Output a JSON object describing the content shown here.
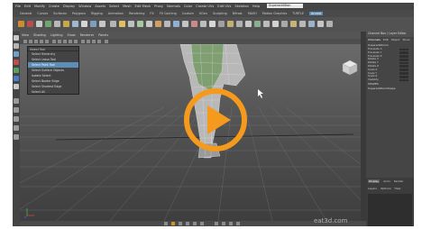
{
  "menubar": {
    "items": [
      "File",
      "Edit",
      "Modify",
      "Create",
      "Display",
      "Window",
      "Assets",
      "Select",
      "Mesh",
      "Edit Mesh",
      "Proxy",
      "Normals",
      "Color",
      "Create UVs",
      "Edit UVs",
      "Skeleton",
      "Help"
    ],
    "search_value": "Superaddition"
  },
  "modebar": {
    "items": [
      "General",
      "Curves",
      "Surfaces",
      "Polygons",
      "Rigging",
      "Animation",
      "Rendering",
      "FX",
      "FX Caching",
      "Custom",
      "XGen",
      "Sculpting",
      "Bifrost",
      "MASH",
      "Motion Graphics",
      "TURTLE",
      "Arnold"
    ],
    "active": "Arnold"
  },
  "viewport": {
    "menu": [
      "View",
      "Shading",
      "Lighting",
      "Show",
      "Renderer",
      "Panels"
    ]
  },
  "dropdown": {
    "title": "Select Tool",
    "items": [
      "Select Hierarchy",
      "Select Lasso Tool",
      "Select Paint Tool",
      "Select Surface Objects",
      "Isolate Select",
      "Select Border Edge",
      "Select Shortest Edge",
      "Select All"
    ],
    "selected_index": 2
  },
  "channel_box": {
    "header": "Channel Box / Layer Editor",
    "tabs": [
      "Channels",
      "Edit",
      "Object",
      "Show"
    ],
    "object_name": "Superaddition1",
    "attributes": [
      "Translate X",
      "Translate Y",
      "Translate Z",
      "Rotate X",
      "Rotate Y",
      "Rotate Z",
      "Scale X",
      "Scale Y",
      "Scale Z",
      "Visibility"
    ],
    "shapes_label": "SHAPES",
    "shape_name": "SuperadditionShape"
  },
  "layer_editor": {
    "tabs": [
      "Display",
      "Anim",
      "Render"
    ],
    "active_tab": "Display",
    "submenu": [
      "Layers",
      "Options",
      "Help"
    ]
  },
  "watermark": "eat3d.com",
  "colors": {
    "play_orange": "#f59a1c",
    "accent_blue": "#5a8db8",
    "panel_gray": "#454545"
  },
  "icons": [
    "play-icon",
    "cursor-icon",
    "view-cube-icon",
    "axis-indicator-icon"
  ]
}
